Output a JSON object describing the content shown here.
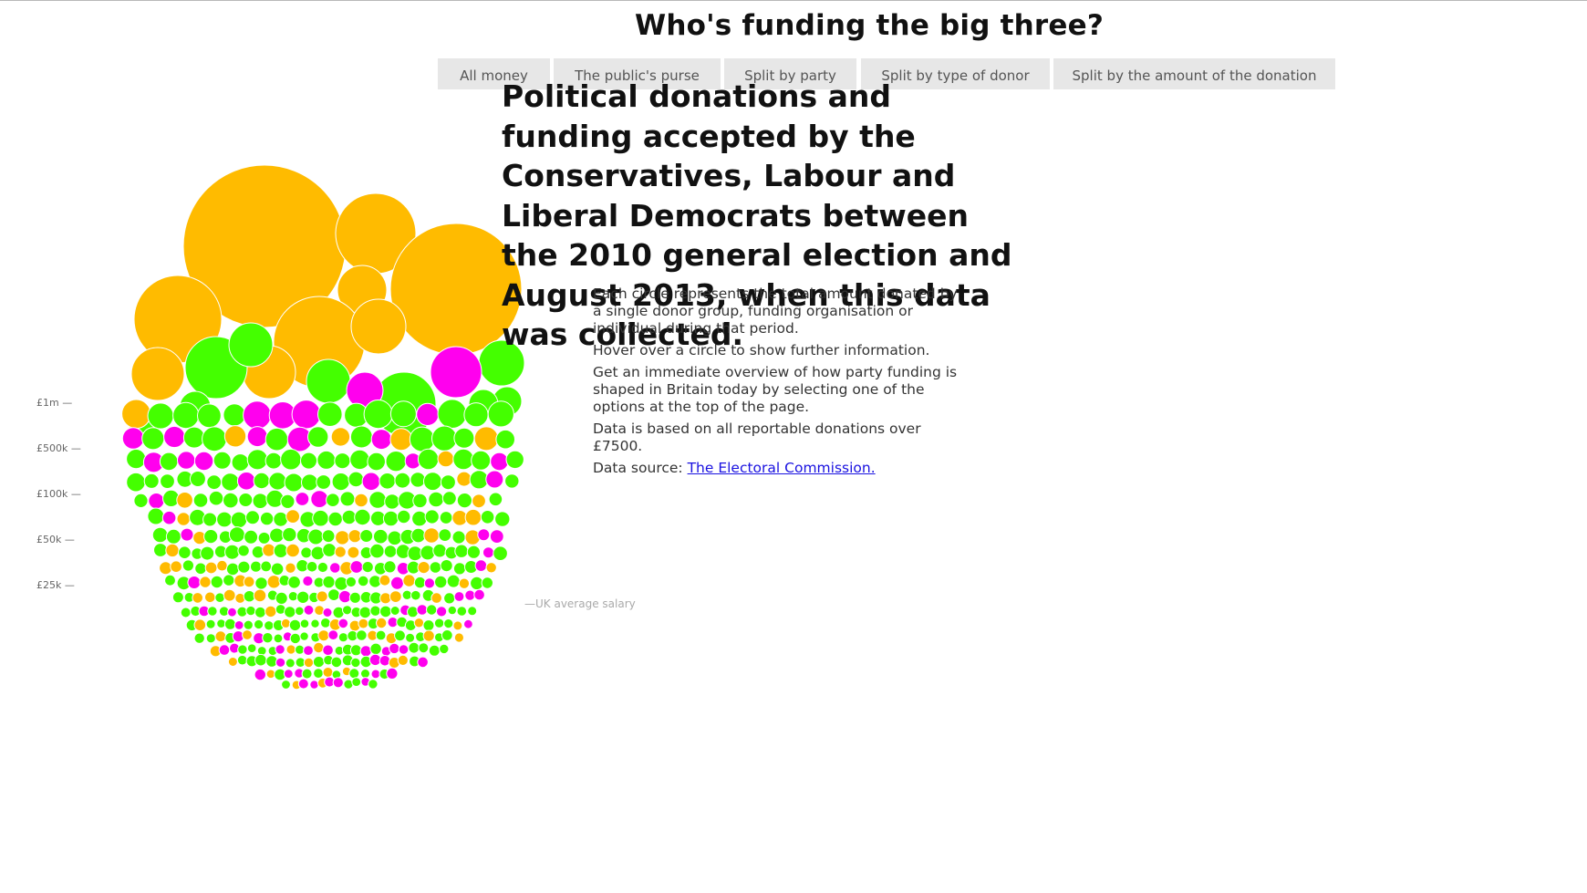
{
  "page": {
    "title": "Who's funding the big three?"
  },
  "nav": {
    "buttons": [
      {
        "label": "All money"
      },
      {
        "label": "The public's purse"
      },
      {
        "label": "Split by party"
      },
      {
        "label": "Split by type of donor"
      },
      {
        "label": "Split by the amount of the donation"
      }
    ]
  },
  "intro": {
    "headline": "Political donations and funding accepted by the Conservatives, Labour and Liberal Democrats between the 2010 general election and August 2013, when this data was collected.",
    "paragraph_1": "Each circle represents the total amount donated by a single donor group, funding organisation or individual during that period.",
    "paragraph_2": "Hover over a circle to show further information.",
    "paragraph_3": "Get an immediate overview of how party funding is shaped in Britain today by selecting one of the options at the top of the page.",
    "paragraph_4": "Data is based on all reportable donations over £7500.",
    "source_prefix": "Data source: ",
    "source_link": "The Electoral Commission."
  },
  "scale": {
    "labels": [
      "£1m —",
      "£500k —",
      "£100k —",
      "£50k —",
      "£25k —"
    ],
    "salary_note": "—UK average salary"
  },
  "colors": {
    "orange": "#ffbb00",
    "green": "#44ff00",
    "magenta": "#ff00ee",
    "stroke": "#ffffff"
  }
}
